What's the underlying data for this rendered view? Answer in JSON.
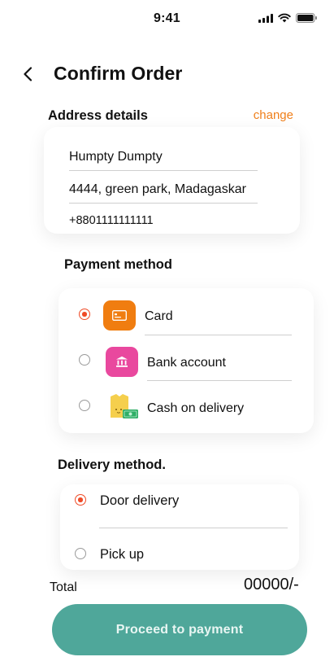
{
  "status_bar": {
    "time": "9:41"
  },
  "header": {
    "title": "Confirm Order"
  },
  "address": {
    "section_title": "Address details",
    "change_label": "change",
    "name": "Humpty Dumpty",
    "street": "4444, green park, Madagaskar",
    "phone": "+8801111111111"
  },
  "payment": {
    "section_title": "Payment method",
    "selected": "Card",
    "options": [
      {
        "label": "Card",
        "icon": "card-icon",
        "color": "#f07d10",
        "checked": true
      },
      {
        "label": "Bank account",
        "icon": "bank-icon",
        "color": "#e9489e",
        "checked": false
      },
      {
        "label": "Cash on delivery",
        "icon": "cash-icon",
        "color": "#f5cf4d",
        "checked": false
      }
    ]
  },
  "delivery": {
    "section_title": "Delivery method.",
    "selected": "Door delivery",
    "options": [
      {
        "label": "Door delivery",
        "checked": true
      },
      {
        "label": "Pick up",
        "checked": false
      }
    ]
  },
  "total": {
    "label": "Total",
    "value": "00000/-"
  },
  "proceed_button": {
    "label": "Proceed to payment",
    "color": "#4fa79a"
  },
  "colors": {
    "accent": "#ef4b27",
    "link": "#ef7f1a"
  }
}
